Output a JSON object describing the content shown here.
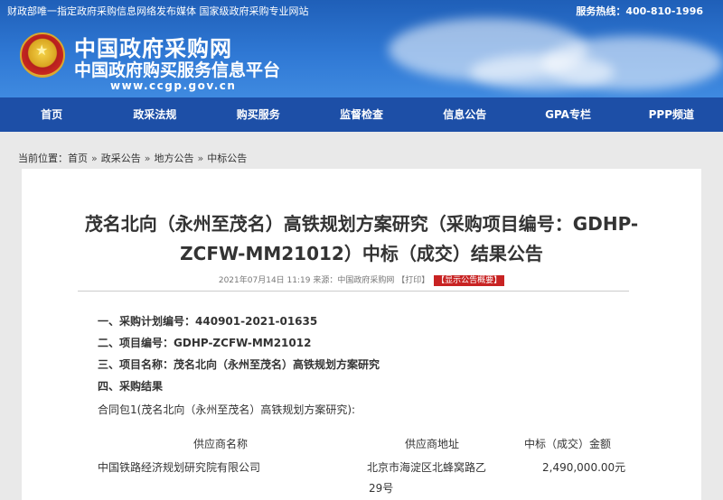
{
  "header": {
    "topbar_left": "财政部唯一指定政府采购信息网络发布媒体 国家级政府采购专业网站",
    "hotline": "服务热线：400-810-1996",
    "site_name": "中国政府采购网",
    "site_subtitle": "中国政府购买服务信息平台",
    "site_url": "www.ccgp.gov.cn"
  },
  "nav": [
    "首页",
    "政采法规",
    "购买服务",
    "监督检查",
    "信息公告",
    "GPA专栏",
    "PPP频道"
  ],
  "breadcrumb": {
    "prefix": "当前位置：",
    "items": [
      "首页",
      "政采公告",
      "地方公告",
      "中标公告"
    ],
    "separator": "»"
  },
  "article": {
    "title": "茂名北向（永州至茂名）高铁规划方案研究（采购项目编号：GDHP-ZCFW-MM21012）中标（成交）结果公告",
    "meta_date": "2021年07月14日 11:19",
    "meta_source": "来源：中国政府采购网",
    "print_label": "【打印】",
    "badge_label": "【显示公告概要】",
    "items": [
      {
        "label": "一、采购计划编号：",
        "value": "440901-2021-01635"
      },
      {
        "label": "二、项目编号：",
        "value": "GDHP-ZCFW-MM21012"
      },
      {
        "label": "三、项目名称：",
        "value": "茂名北向（永州至茂名）高铁规划方案研究"
      },
      {
        "label": "四、采购结果",
        "value": ""
      }
    ],
    "package_line": "合同包1(茂名北向（永州至茂名）高铁规划方案研究):",
    "table": {
      "headers": [
        "供应商名称",
        "供应商地址",
        "中标（成交）金额"
      ],
      "rows": [
        {
          "supplier": "中国铁路经济规划研究院有限公司",
          "address_line1": "北京市海淀区北蜂窝路乙",
          "address_line2": "29号",
          "amount": "2,490,000.00元"
        }
      ]
    }
  },
  "colors": {
    "header_blue": "#2f78d4",
    "nav_blue": "#1d4fa7",
    "badge_red": "#c82323",
    "page_bg": "#e9e9e9"
  }
}
